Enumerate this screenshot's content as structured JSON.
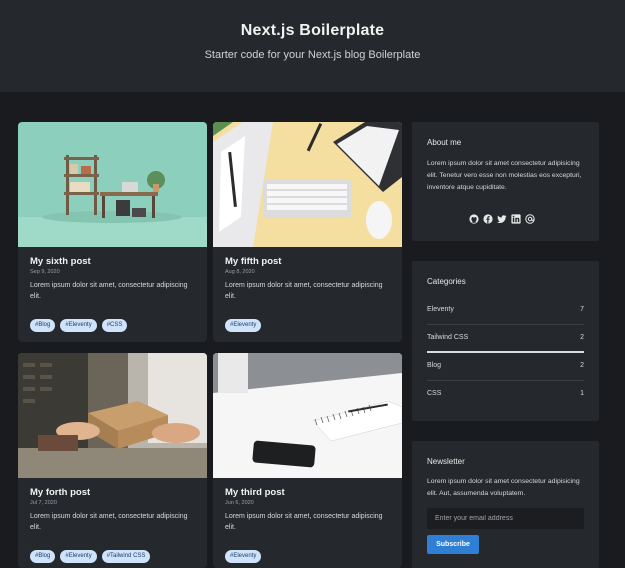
{
  "header": {
    "title": "Next.js Boilerplate",
    "subtitle": "Starter code for your Next.js blog Boilerplate"
  },
  "posts": [
    {
      "title": "My sixth post",
      "date": "Sep 9, 2020",
      "excerpt": "Lorem ipsum dolor sit amet, consectetur adipiscing elit.",
      "tags": [
        "#Blog",
        "#Eleventy",
        "#CSS"
      ],
      "image": "desk-shelf-photo"
    },
    {
      "title": "My fifth post",
      "date": "Aug 8, 2020",
      "excerpt": "Lorem ipsum dolor sit amet, consectetur adipiscing elit.",
      "tags": [
        "#Eleventy"
      ],
      "image": "keyboard-notebook-photo"
    },
    {
      "title": "My forth post",
      "date": "Jul 7, 2020",
      "excerpt": "Lorem ipsum dolor sit amet, consectetur adipiscing elit.",
      "tags": [
        "#Blog",
        "#Eleventy",
        "#Tailwind CSS"
      ],
      "image": "package-handoff-photo"
    },
    {
      "title": "My third post",
      "date": "Jun 6, 2020",
      "excerpt": "Lorem ipsum dolor sit amet, consectetur adipiscing elit.",
      "tags": [
        "#Eleventy"
      ],
      "image": "phone-notebook-photo"
    }
  ],
  "about": {
    "title": "About me",
    "text": "Lorem ipsum dolor sit amet consectetur adipisicing elit. Tenetur vero esse non molestias eos excepturi, inventore atque cupiditate.",
    "socials": [
      "github-icon",
      "facebook-icon",
      "twitter-icon",
      "linkedin-icon",
      "email-at-icon"
    ]
  },
  "categories": {
    "title": "Categories",
    "items": [
      {
        "name": "Eleventy",
        "count": "7"
      },
      {
        "name": "Tailwind CSS",
        "count": "2"
      },
      {
        "name": "Blog",
        "count": "2"
      },
      {
        "name": "CSS",
        "count": "1"
      }
    ]
  },
  "newsletter": {
    "title": "Newsletter",
    "text": "Lorem ipsum dolor sit amet consectetur adipisicing elit. Aut, assumenda voluptatem.",
    "email_placeholder": "Enter your email address",
    "email_value": "",
    "button_label": "Subscribe"
  },
  "colors": {
    "page_bg": "#191b1e",
    "card_bg": "#25282c",
    "tag_bg": "#cfe3fb",
    "accent": "#2f7fd4"
  }
}
